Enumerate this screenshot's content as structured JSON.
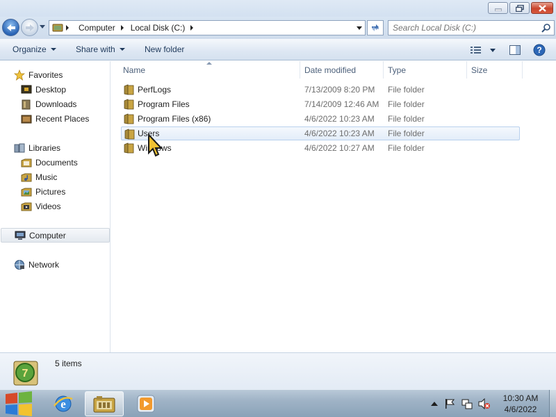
{
  "window": {
    "minimize_icon": "minimize-icon",
    "maximize_icon": "restore-icon",
    "close_icon": "close-icon"
  },
  "address": {
    "segments": [
      "Computer",
      "Local Disk (C:)"
    ],
    "search_placeholder": "Search Local Disk (C:)"
  },
  "toolbar": {
    "organize": "Organize",
    "share_with": "Share with",
    "new_folder": "New folder"
  },
  "nav": {
    "favorites": {
      "label": "Favorites",
      "items": [
        "Desktop",
        "Downloads",
        "Recent Places"
      ]
    },
    "libraries": {
      "label": "Libraries",
      "items": [
        "Documents",
        "Music",
        "Pictures",
        "Videos"
      ]
    },
    "computer": "Computer",
    "network": "Network"
  },
  "columns": [
    "Name",
    "Date modified",
    "Type",
    "Size"
  ],
  "files": [
    {
      "name": "PerfLogs",
      "date": "7/13/2009 8:20 PM",
      "type": "File folder",
      "size": ""
    },
    {
      "name": "Program Files",
      "date": "7/14/2009 12:46 AM",
      "type": "File folder",
      "size": ""
    },
    {
      "name": "Program Files (x86)",
      "date": "4/6/2022 10:23 AM",
      "type": "File folder",
      "size": ""
    },
    {
      "name": "Users",
      "date": "4/6/2022 10:23 AM",
      "type": "File folder",
      "size": ""
    },
    {
      "name": "Windows",
      "date": "4/6/2022 10:27 AM",
      "type": "File folder",
      "size": ""
    }
  ],
  "selected_file": "Users",
  "details": {
    "count": "5 items"
  },
  "taskbar": {
    "time": "10:30 AM",
    "date": "4/6/2022"
  },
  "colors": {
    "accent": "#1e395b",
    "selection": "#e3edf9",
    "folder": "#c9a544"
  }
}
